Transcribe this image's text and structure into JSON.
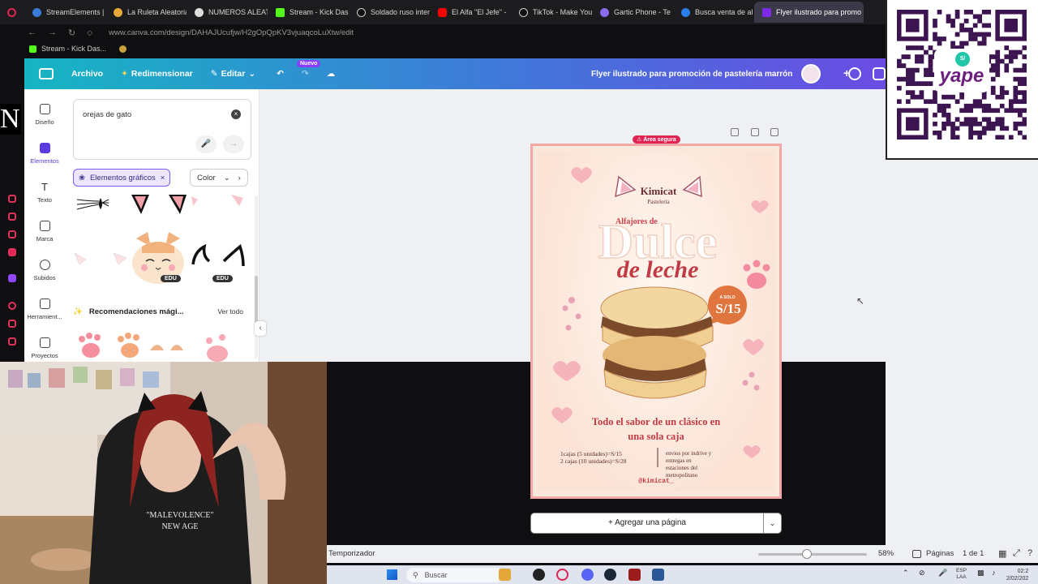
{
  "browser": {
    "tabs": [
      {
        "label": "StreamElements |",
        "color": "#3b7bd8"
      },
      {
        "label": "La Ruleta Aleatoria",
        "color": "#e8a83a"
      },
      {
        "label": "NUMEROS ALEAT",
        "color": "#dddddd"
      },
      {
        "label": "Stream - Kick Das",
        "color": "#53fc18"
      },
      {
        "label": "Soldado ruso inter",
        "color": "#111111"
      },
      {
        "label": "El Alfa \"El Jefe\" -",
        "color": "#ff0000"
      },
      {
        "label": "TikTok - Make You",
        "color": "#111111"
      },
      {
        "label": "Gartic Phone - Te",
        "color": "#8a6cf0"
      },
      {
        "label": "Busca venta de al",
        "color": "#2b7de9"
      },
      {
        "label": "Flyer ilustrado para promo",
        "color": "#7d2ae8"
      }
    ],
    "url": "www.canva.com/design/DAHAJUcufjw/H2gOpQpKV3vjuaqcoLuXtw/edit",
    "bookmark": "Stream - Kick Das..."
  },
  "overlay_letter": "N",
  "canva": {
    "header": {
      "archivo": "Archivo",
      "redimensionar": "Redimensionar",
      "editar": "Editar",
      "nuevo": "Nuevo",
      "title": "Flyer ilustrado para promoción de pastelería marrón"
    },
    "nav": [
      {
        "label": "Diseño"
      },
      {
        "label": "Elementos"
      },
      {
        "label": "Texto"
      },
      {
        "label": "Marca"
      },
      {
        "label": "Subidos"
      },
      {
        "label": "Herramient..."
      },
      {
        "label": "Proyectos"
      }
    ],
    "search": {
      "value": "orejas de gato"
    },
    "chips": {
      "elementos": "Elementos gráficos",
      "color": "Color"
    },
    "edu_badge": "EDU",
    "magic": {
      "label": "Recomendaciones mági...",
      "ver": "Ver todo"
    },
    "area_segura": "Área segura",
    "add_page": "+ Agregar una página",
    "status": {
      "temporizador": "Temporizador",
      "zoom": "58%",
      "paginas": "Páginas",
      "page_of": "1 de 1"
    }
  },
  "flyer": {
    "brand": "Kimicat",
    "brand_sub": "Pastelería",
    "pre_title": "Alfajores de",
    "title1": "Dulce",
    "title2": "de leche",
    "badge_top": "A SOLO",
    "badge_price": "S/15",
    "tagline": "Todo el sabor de un clásico en una sola caja",
    "prices": [
      "1cajas (5 unidades)=S/15",
      "2 cajas (10 unidades)=S/28"
    ],
    "delivery": "envios por indrive y entregas en estaciones del metropolitano",
    "handle": "@kimicat_"
  },
  "webcam": {
    "shirt_line1": "\"MALEVOLENCE\"",
    "shirt_line2": "NEW AGE"
  },
  "qr": {
    "brand": "yape"
  },
  "taskbar": {
    "search": "Buscar",
    "lang1": "ESP",
    "lang2": "LAA",
    "time": "02:2",
    "date": "2/02/202"
  }
}
